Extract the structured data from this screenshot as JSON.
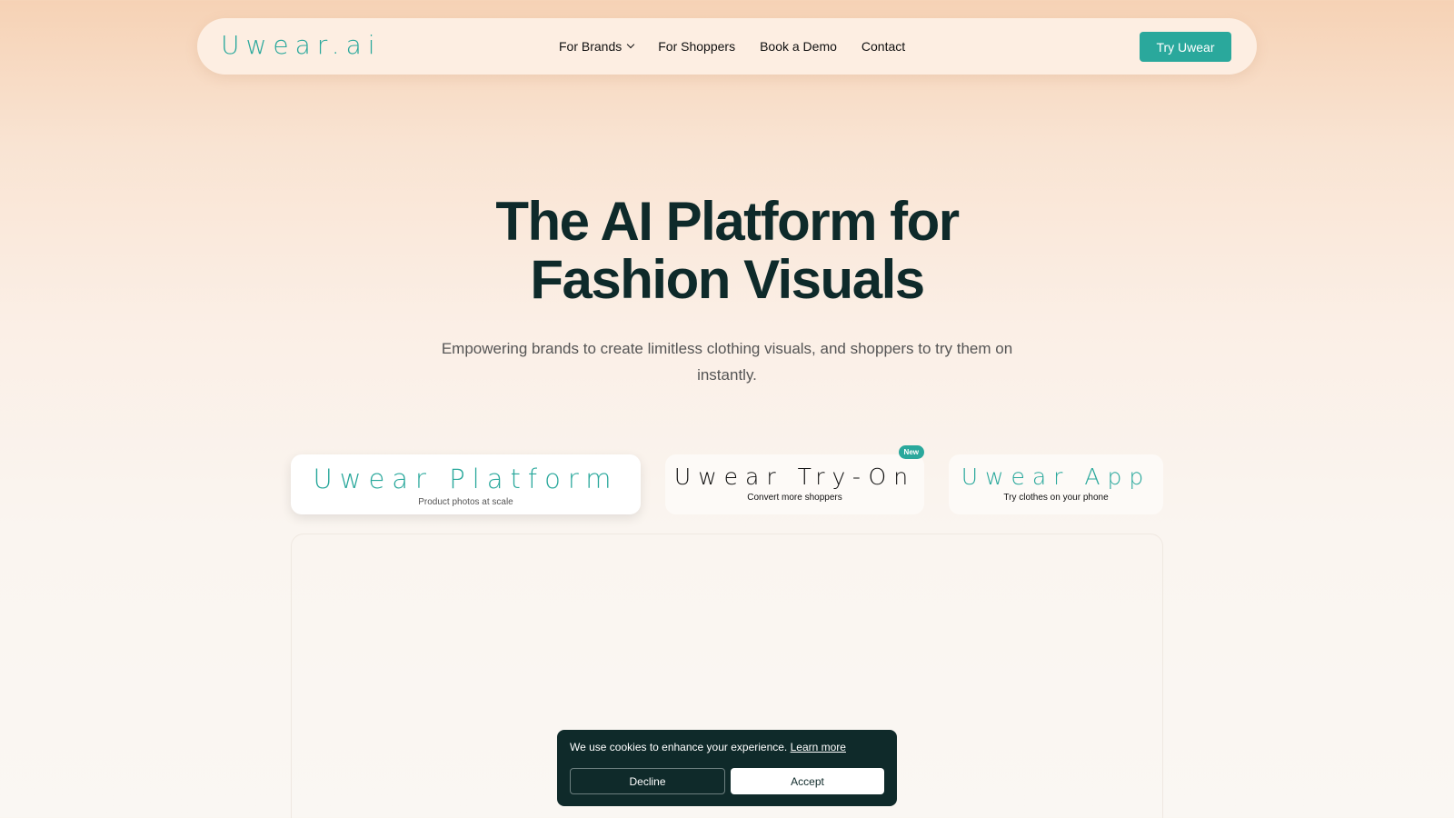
{
  "brand": {
    "logo": "Uwear.ai",
    "accent": "#2aa89c",
    "dark": "#0f2a2a"
  },
  "nav": {
    "items": [
      {
        "label": "For Brands",
        "has_dropdown": true
      },
      {
        "label": "For Shoppers"
      },
      {
        "label": "Book a Demo"
      },
      {
        "label": "Contact"
      }
    ],
    "cta": "Try Uwear"
  },
  "hero": {
    "title_line1": "The AI Platform for",
    "title_line2": "Fashion Visuals",
    "subtitle": "Empowering brands to create limitless clothing visuals, and shoppers to try them on instantly."
  },
  "tabs": [
    {
      "title": "Uwear Platform",
      "subtitle": "Product photos at scale",
      "active": true
    },
    {
      "title": "Uwear Try-On",
      "subtitle": "Convert more shoppers",
      "badge": "New"
    },
    {
      "title": "Uwear App",
      "subtitle": "Try clothes on your phone"
    }
  ],
  "cookie": {
    "text": "We use cookies to enhance your experience.",
    "link": "Learn more",
    "decline": "Decline",
    "accept": "Accept"
  }
}
